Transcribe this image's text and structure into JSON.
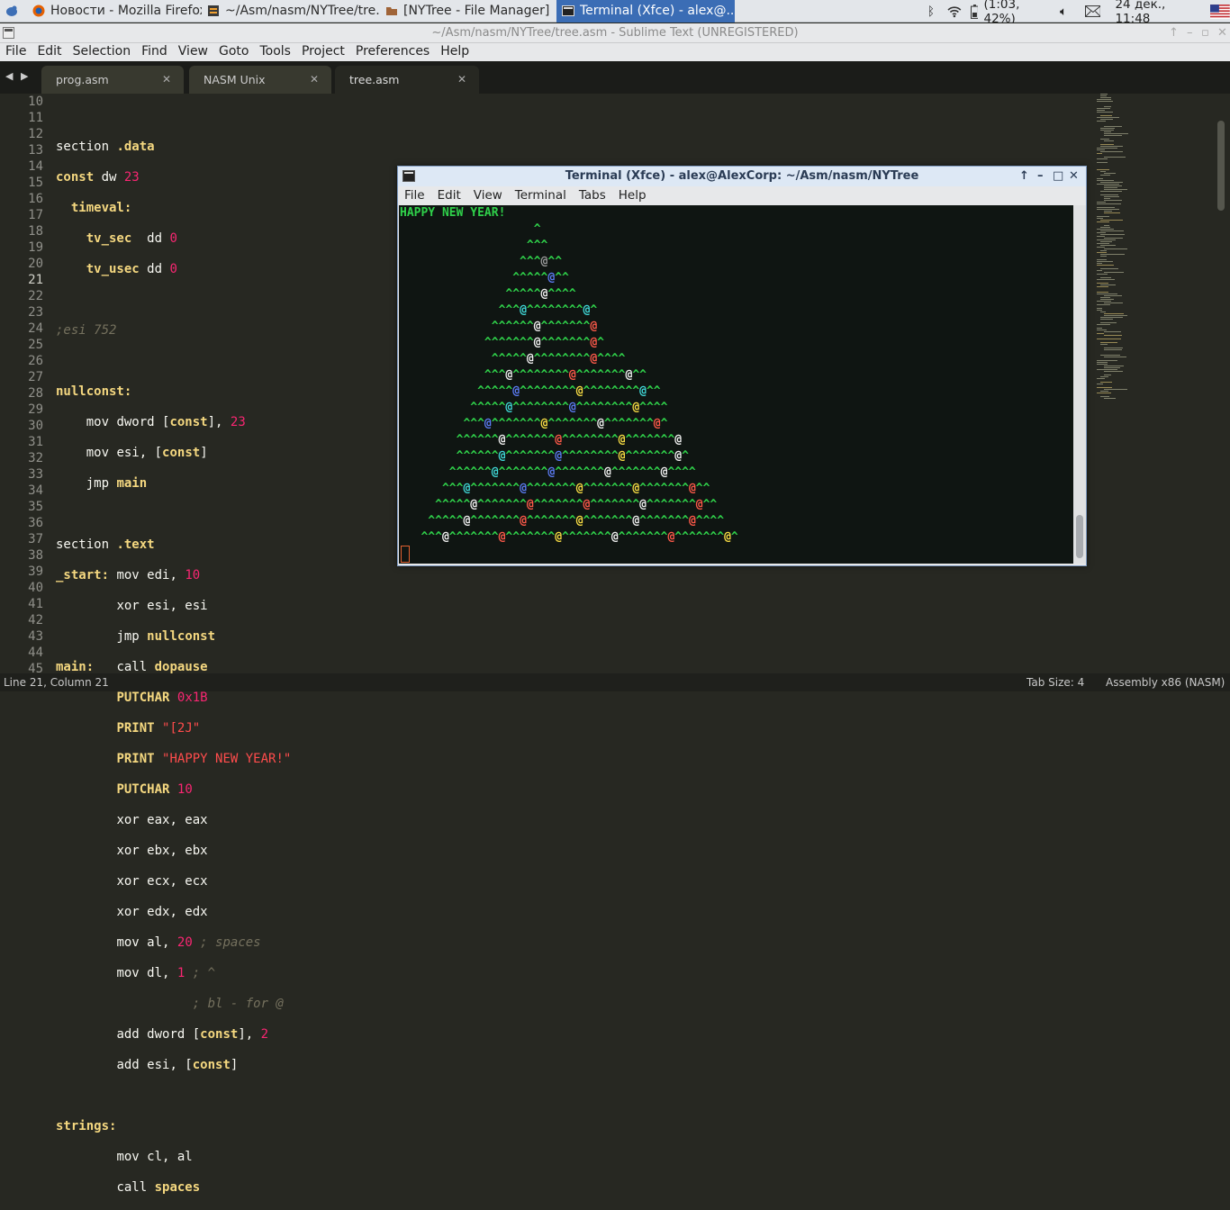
{
  "panel": {
    "tasks": [
      {
        "label": "Новости - Mozilla Firefox",
        "icon": "firefox-icon"
      },
      {
        "label": "~/Asm/nasm/NYTree/tre...",
        "icon": "sublime-icon"
      },
      {
        "label": "[NYTree - File Manager]",
        "icon": "folder-icon"
      },
      {
        "label": "Terminal (Xfce) - alex@...",
        "icon": "terminal-icon"
      }
    ],
    "battery": "(1:03, 42%)",
    "clock": "24 дек., 11:48"
  },
  "sublime": {
    "title": "~/Asm/nasm/NYTree/tree.asm - Sublime Text (UNREGISTERED)",
    "menu": [
      "File",
      "Edit",
      "Selection",
      "Find",
      "View",
      "Goto",
      "Tools",
      "Project",
      "Preferences",
      "Help"
    ],
    "tabs": [
      {
        "label": "prog.asm"
      },
      {
        "label": "NASM Unix"
      },
      {
        "label": "tree.asm"
      }
    ],
    "line_numbers": [
      "10",
      "11",
      "12",
      "13",
      "14",
      "15",
      "16",
      "17",
      "18",
      "19",
      "20",
      "21",
      "22",
      "23",
      "24",
      "25",
      "26",
      "27",
      "28",
      "29",
      "30",
      "31",
      "32",
      "33",
      "34",
      "35",
      "36",
      "37",
      "38",
      "39",
      "40",
      "41",
      "42",
      "43",
      "44",
      "45"
    ],
    "code": {
      "l11a": "section ",
      "l11b": ".data",
      "l12a": "const",
      " l12b": " dw ",
      "l12c": "23",
      "l13": "timeval:",
      "l14a": "tv_sec",
      "l14b": "  dd ",
      "l14c": "0",
      "l15a": "tv_usec",
      "l15b": " dd ",
      "l15c": "0",
      "l17": ";esi 752",
      "l19": "nullconst:",
      "l20a": "mov",
      " l20b": " dword [",
      "l20c": "const",
      "l20d": "], ",
      "l20e": "23",
      "l21a": "mov",
      " l21b": " esi, [",
      "l21c": "const",
      "l21d": "]",
      "l22a": "jmp",
      " l22b": "main",
      "l24a": "section ",
      "l24b": ".text",
      "l25a": "_start:",
      " l25b": "mov",
      " l25c": " edi, ",
      "l25d": "10",
      "l26a": "xor",
      " l26b": " esi, esi",
      "l27a": "jmp",
      " l27b": "nullconst",
      "l28a": "main:",
      " l28b": "call",
      " l28c": "dopause",
      "l29a": "PUTCHAR",
      " l29b": "0x1B",
      "l30a": "PRINT",
      " l30b": "\"[2J\"",
      "l31a": "PRINT",
      " l31b": "\"HAPPY NEW YEAR!\"",
      "l32a": "PUTCHAR",
      " l32b": "10",
      "l33a": "xor",
      " l33b": " eax, eax",
      "l34a": "xor",
      " l34b": " ebx, ebx",
      "l35a": "xor",
      " l35b": " ecx, ecx",
      "l36a": "xor",
      " l36b": " edx, edx",
      "l37a": "mov",
      " l37b": " al, ",
      "l37c": "20",
      "l37d": " ; spaces",
      "l38a": "mov",
      " l38b": " dl, ",
      "l38c": "1",
      "l38d": " ; ^",
      "l39": "; bl - for @",
      "l40a": "add",
      " l40b": " dword [",
      "l40c": "const",
      "l40d": "], ",
      "l40e": "2",
      "l41a": "add",
      " l41b": " esi, [",
      "l41c": "const",
      "l41d": "]",
      "l43": "strings:",
      "l44a": "mov",
      " l44b": " cl, al",
      "l45a": "call",
      " l45b": "spaces"
    },
    "status_left": "Line 21, Column 21",
    "tab_size": "Tab Size: 4",
    "syntax": "Assembly x86 (NASM)"
  },
  "terminal": {
    "title": "Terminal (Xfce) - alex@AlexCorp: ~/Asm/nasm/NYTree",
    "menu": [
      "File",
      "Edit",
      "View",
      "Terminal",
      "Tabs",
      "Help"
    ],
    "greeting": "HAPPY NEW YEAR!"
  },
  "colors": {
    "accent": "#3b6db5",
    "tree_green": "#2fd04a"
  }
}
